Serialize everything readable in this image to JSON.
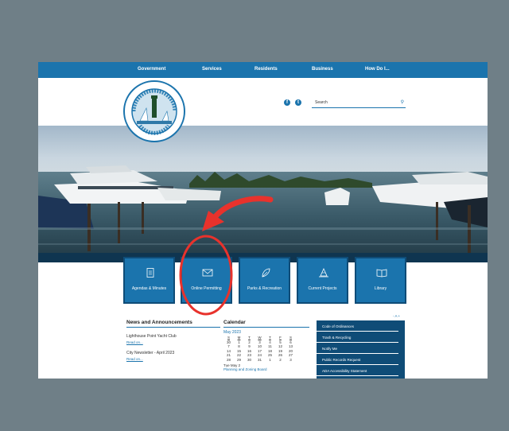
{
  "nav": {
    "items": [
      "Government",
      "Services",
      "Residents",
      "Business",
      "How Do I..."
    ]
  },
  "header": {
    "seal_top_text": "CITY OF LIGHTHOUSE POINT FLORIDA",
    "seal_bottom_text": "JUNE 1956",
    "social": [
      "facebook-icon",
      "twitter-icon"
    ],
    "search": {
      "placeholder": "Search"
    }
  },
  "quicklinks": [
    {
      "label": "Agendas & Minutes",
      "icon": "document-icon"
    },
    {
      "label": "Online Permitting",
      "icon": "envelope-icon"
    },
    {
      "label": "Parks & Recreation",
      "icon": "leaf-icon"
    },
    {
      "label": "Current Projects",
      "icon": "cone-icon"
    },
    {
      "label": "Library",
      "icon": "book-icon"
    }
  ],
  "news": {
    "title": "News and Announcements",
    "items": [
      {
        "title": "Lighthouse Point Yacht Club",
        "more": "Read on..."
      },
      {
        "title": "City Newsletter - April 2023",
        "more": "Read on..."
      }
    ]
  },
  "calendar": {
    "title": "Calendar",
    "month": "May 2023",
    "days": [
      "S",
      "M",
      "T",
      "W",
      "T",
      "F",
      "S"
    ],
    "dates": [
      "30",
      "1",
      "2",
      "3",
      "4",
      "5",
      "6",
      "7",
      "8",
      "9",
      "10",
      "11",
      "12",
      "13",
      "14",
      "15",
      "16",
      "17",
      "18",
      "19",
      "20",
      "21",
      "22",
      "23",
      "24",
      "25",
      "26",
      "27",
      "28",
      "29",
      "30",
      "31",
      "1",
      "2",
      "3"
    ],
    "event_date": "Tue May 2",
    "event": "Planning and Zoning Board"
  },
  "text_size": "- A +",
  "sidelinks": [
    "Code of Ordinances",
    "Trash & Recycling",
    "Notify Me",
    "Public Records Request",
    "ADA Accessibility Statement"
  ],
  "colors": {
    "primary": "#1b74ad",
    "dark": "#0f4c77",
    "annotation": "#e8322c",
    "backdrop": "#6f7f87"
  }
}
